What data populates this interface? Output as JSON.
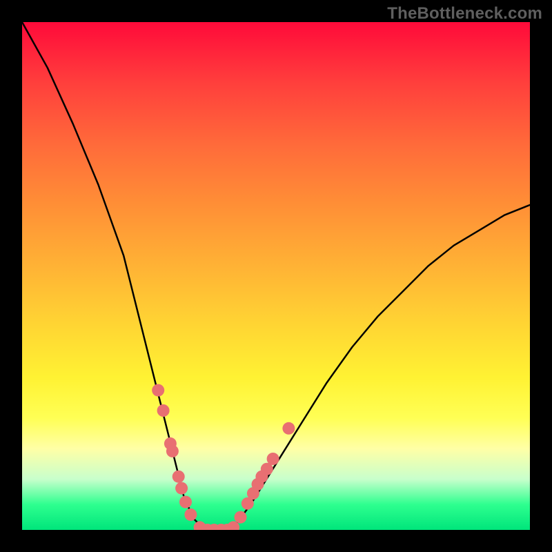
{
  "watermark": "TheBottleneck.com",
  "chart_data": {
    "type": "line",
    "title": "",
    "xlabel": "",
    "ylabel": "",
    "xlim": [
      0,
      1
    ],
    "ylim": [
      0,
      1
    ],
    "series": [
      {
        "name": "bottleneck-curve",
        "x": [
          0.0,
          0.05,
          0.1,
          0.15,
          0.2,
          0.25,
          0.275,
          0.3,
          0.32,
          0.34,
          0.36,
          0.38,
          0.4,
          0.42,
          0.45,
          0.5,
          0.55,
          0.6,
          0.65,
          0.7,
          0.75,
          0.8,
          0.85,
          0.9,
          0.95,
          1.0
        ],
        "y": [
          1.0,
          0.91,
          0.8,
          0.68,
          0.54,
          0.34,
          0.24,
          0.14,
          0.06,
          0.02,
          0.0,
          0.0,
          0.0,
          0.01,
          0.05,
          0.13,
          0.21,
          0.29,
          0.36,
          0.42,
          0.47,
          0.52,
          0.56,
          0.59,
          0.62,
          0.64
        ]
      }
    ],
    "markers": {
      "name": "highlight-dots",
      "color": "#e86f72",
      "points": [
        {
          "x": 0.268,
          "y": 0.275
        },
        {
          "x": 0.278,
          "y": 0.235
        },
        {
          "x": 0.292,
          "y": 0.17
        },
        {
          "x": 0.296,
          "y": 0.155
        },
        {
          "x": 0.308,
          "y": 0.105
        },
        {
          "x": 0.314,
          "y": 0.082
        },
        {
          "x": 0.322,
          "y": 0.055
        },
        {
          "x": 0.332,
          "y": 0.03
        },
        {
          "x": 0.35,
          "y": 0.005
        },
        {
          "x": 0.365,
          "y": 0.0
        },
        {
          "x": 0.378,
          "y": 0.0
        },
        {
          "x": 0.392,
          "y": 0.0
        },
        {
          "x": 0.404,
          "y": 0.0
        },
        {
          "x": 0.416,
          "y": 0.005
        },
        {
          "x": 0.43,
          "y": 0.025
        },
        {
          "x": 0.444,
          "y": 0.052
        },
        {
          "x": 0.455,
          "y": 0.072
        },
        {
          "x": 0.464,
          "y": 0.09
        },
        {
          "x": 0.472,
          "y": 0.105
        },
        {
          "x": 0.482,
          "y": 0.12
        },
        {
          "x": 0.494,
          "y": 0.14
        },
        {
          "x": 0.525,
          "y": 0.2
        }
      ]
    }
  }
}
